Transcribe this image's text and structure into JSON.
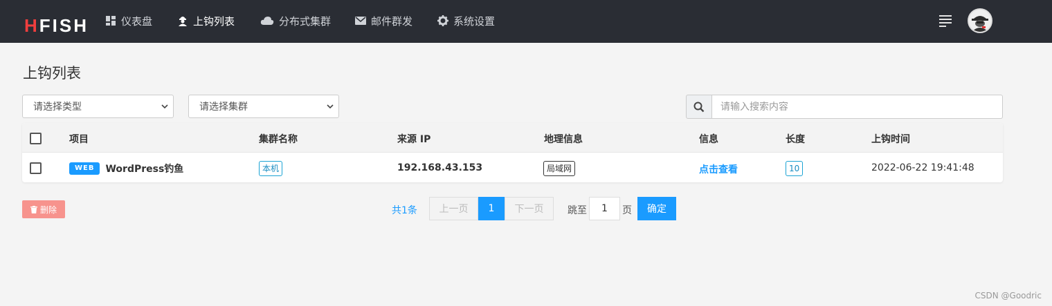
{
  "brand": {
    "logo_h": "H",
    "logo_rest": "FISH"
  },
  "nav": {
    "items": [
      {
        "label": "仪表盘",
        "icon": "dashboard-icon"
      },
      {
        "label": "上钩列表",
        "icon": "hacker-icon",
        "active": true
      },
      {
        "label": "分布式集群",
        "icon": "cloud-icon"
      },
      {
        "label": "邮件群发",
        "icon": "mail-icon"
      },
      {
        "label": "系统设置",
        "icon": "gear-icon"
      }
    ]
  },
  "page": {
    "title": "上钩列表"
  },
  "filters": {
    "type_select": "请选择类型",
    "cluster_select": "请选择集群",
    "search_placeholder": "请输入搜索内容"
  },
  "table": {
    "columns": [
      "项目",
      "集群名称",
      "来源 IP",
      "地理信息",
      "信息",
      "长度",
      "上钩时间"
    ],
    "rows": [
      {
        "tag": "WEB",
        "project": "WordPress钓鱼",
        "cluster": "本机",
        "ip": "192.168.43.153",
        "geo": "局域网",
        "info": "点击查看",
        "length": "10",
        "time": "2022-06-22 19:41:48"
      }
    ]
  },
  "actions": {
    "delete": "删除"
  },
  "pagination": {
    "total": "共1条",
    "prev": "上一页",
    "current": "1",
    "next": "下一页",
    "jump_to": "跳至",
    "jump_value": "1",
    "page_unit": "页",
    "confirm": "确定"
  },
  "watermark": "CSDN @Goodric",
  "colors": {
    "topbar": "#2a2d34",
    "accent": "#1a9bff",
    "danger": "#f7938d",
    "logo_red": "#f03e3e"
  }
}
